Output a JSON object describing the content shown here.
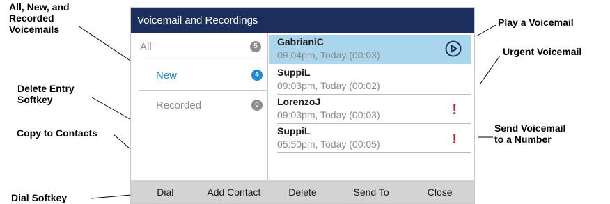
{
  "callouts": {
    "all_new_recorded": "All, New, and\nRecorded\nVoicemails",
    "delete_entry": "Delete Entry\n Softkey",
    "copy_to_contacts": "Copy to Contacts",
    "dial_softkey": "Dial Softkey",
    "play_voicemail": "Play a Voicemail",
    "urgent_voicemail": "Urgent Voicemail",
    "send_voicemail": "Send Voicemail\nto a Number"
  },
  "screen": {
    "title": "Voicemail and Recordings",
    "folders": [
      {
        "label": "All",
        "count": "5",
        "selected": false
      },
      {
        "label": "New",
        "count": "4",
        "selected": true
      },
      {
        "label": "Recorded",
        "count": "0",
        "selected": false
      }
    ],
    "voicemails": [
      {
        "name": "GabrianiC",
        "time": "09:04pm, Today (00:03)",
        "urgent": false,
        "highlighted": true
      },
      {
        "name": "SuppiL",
        "time": "09:03pm, Today (00:02)",
        "urgent": false,
        "highlighted": false
      },
      {
        "name": "LorenzoJ",
        "time": "09:03pm, Today (00:03)",
        "urgent": true,
        "highlighted": false
      },
      {
        "name": "SuppiL",
        "time": "05:50pm, Today (00:05)",
        "urgent": true,
        "highlighted": false
      }
    ],
    "urgent_mark": "!",
    "softkeys": [
      "Dial",
      "Add Contact",
      "Delete",
      "Send To",
      "Close"
    ]
  },
  "colors": {
    "titlebar": "#1b2f5c",
    "selected_row": "#a9d6ec",
    "new_text": "#1a8ad4",
    "badge_grey": "#8c8c8c",
    "badge_blue": "#1a8ad4",
    "urgent": "#e01818",
    "softkey_bar": "#d3d3d3"
  }
}
